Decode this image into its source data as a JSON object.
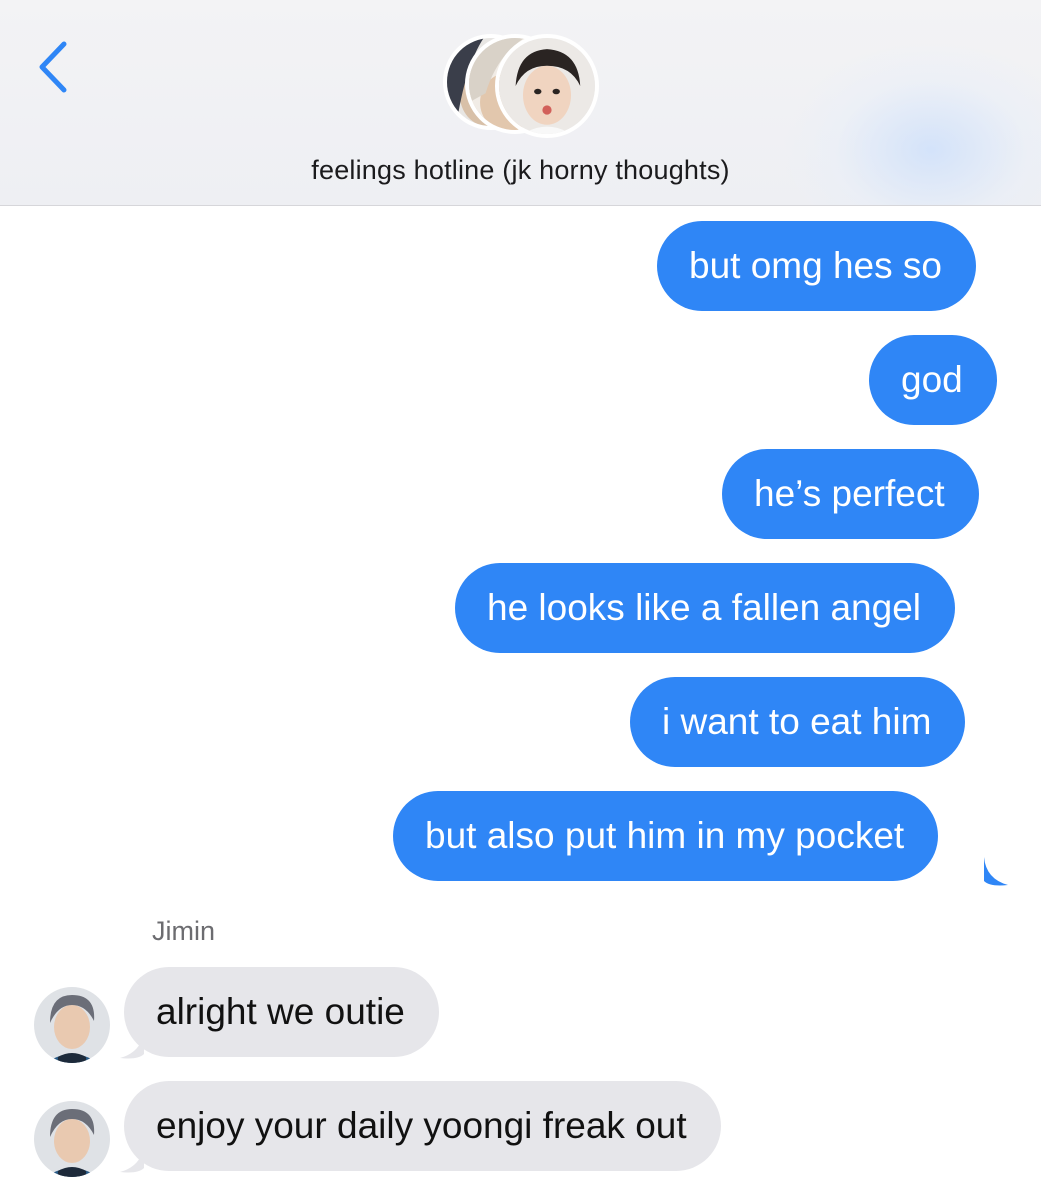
{
  "header": {
    "back_icon": "chevron-left-icon",
    "title": "feelings hotline (jk horny thoughts)",
    "group_avatars": [
      "member-avatar-1",
      "member-avatar-2",
      "member-avatar-3"
    ]
  },
  "messages": {
    "outgoing": [
      "but omg hes so",
      "god",
      "he’s perfect",
      "he looks like a fallen angel",
      "i want to eat him",
      "but also put him in my pocket"
    ],
    "sender_name": "Jimin",
    "incoming": [
      "alright we outie",
      "enjoy your daily yoongi freak out"
    ]
  },
  "colors": {
    "accent": "#2f86f6",
    "outgoing_bubble": "#2f86f6",
    "incoming_bubble": "#e6e6ea"
  }
}
